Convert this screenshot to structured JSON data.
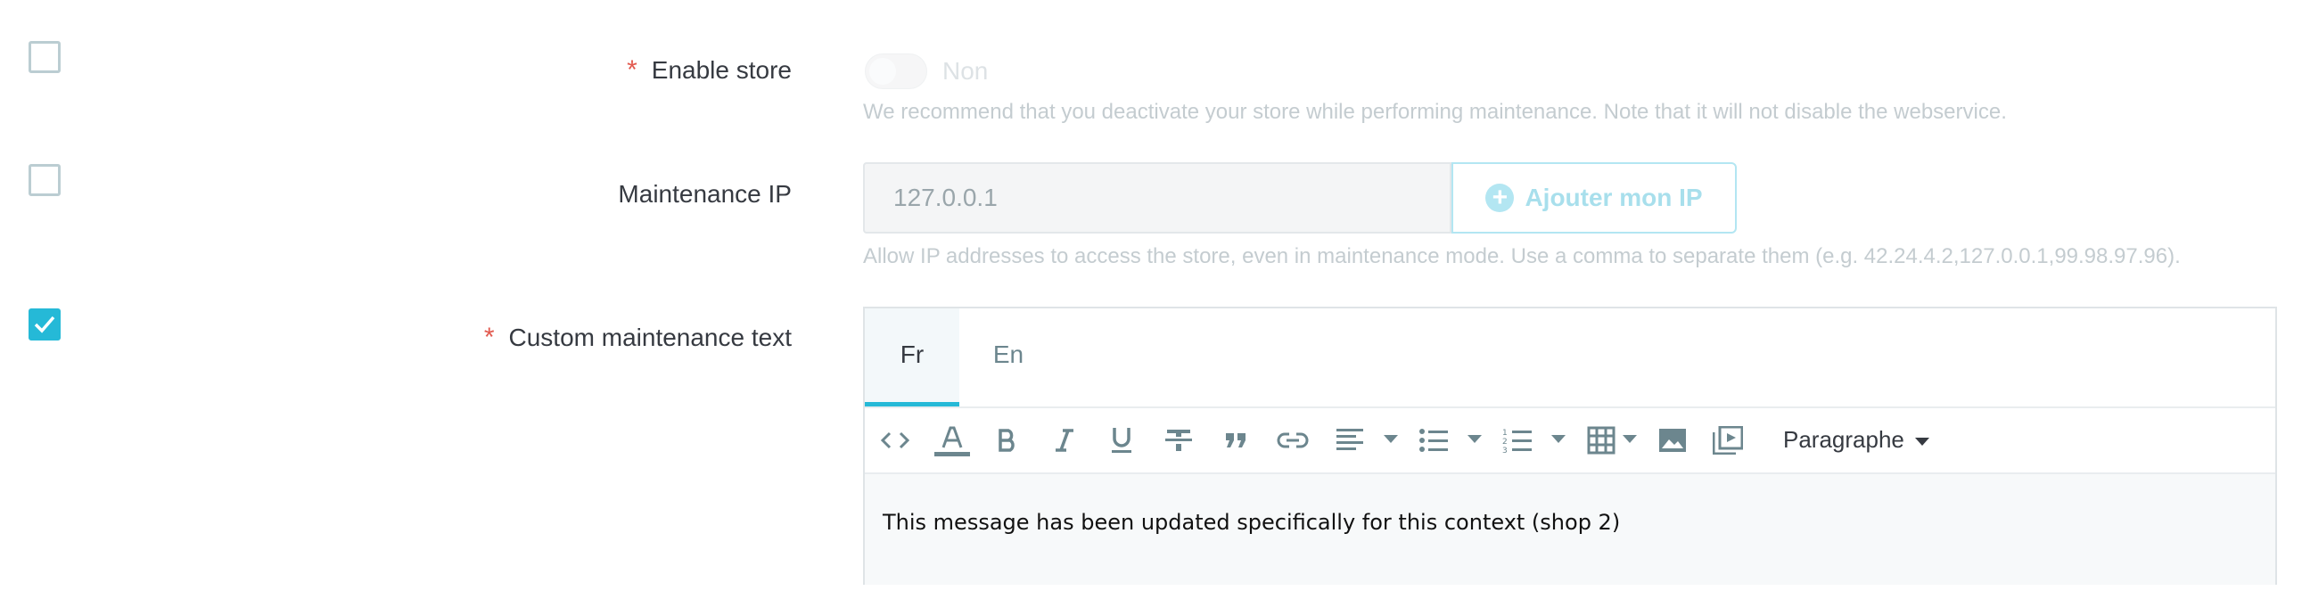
{
  "rows": {
    "enable_store": {
      "label": "Enable store",
      "required": "*",
      "checked": false,
      "toggle_state": "Non",
      "help": "We recommend that you deactivate your store while performing maintenance. Note that it will not disable the webservice."
    },
    "maintenance_ip": {
      "label": "Maintenance IP",
      "checked": false,
      "value": "127.0.0.1",
      "button_label": "Ajouter mon IP",
      "help": "Allow IP addresses to access the store, even in maintenance mode. Use a comma to separate them (e.g. 42.24.4.2,127.0.0.1,99.98.97.96)."
    },
    "custom_text": {
      "label": "Custom maintenance text",
      "required": "*",
      "checked": true,
      "tabs": [
        "Fr",
        "En"
      ],
      "active_tab": "Fr",
      "format_select": "Paragraphe",
      "content": "This message has been updated specifically for this context (shop 2)"
    }
  },
  "toolbar_icons": [
    "code-icon",
    "font-color-icon",
    "bold-icon",
    "italic-icon",
    "underline-icon",
    "strikethrough-icon",
    "blockquote-icon",
    "link-icon",
    "align-icon",
    "bullet-list-icon",
    "numbered-list-icon",
    "table-icon",
    "image-icon",
    "media-icon"
  ],
  "colors": {
    "accent": "#25b9d7",
    "required": "#e25a4f",
    "label": "#363a41",
    "muted": "#c4ccd0"
  }
}
